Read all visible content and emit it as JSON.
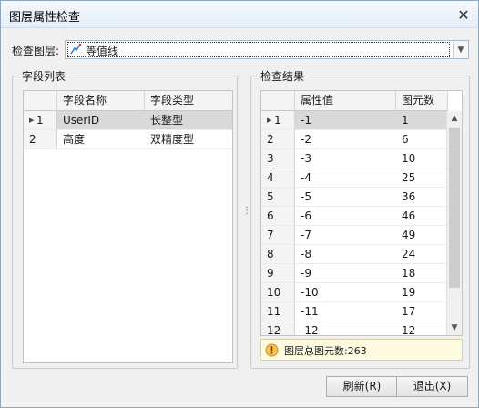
{
  "window": {
    "title": "图层属性检查"
  },
  "layer": {
    "label": "检查图层:",
    "value": "等值线"
  },
  "field_list": {
    "group_title": "字段列表",
    "headers": [
      "字段名称",
      "字段类型"
    ],
    "rows": [
      {
        "num": "1",
        "name": "UserID",
        "type": "长整型",
        "selected": true
      },
      {
        "num": "2",
        "name": "高度",
        "type": "双精度型",
        "selected": false
      }
    ]
  },
  "result": {
    "group_title": "检查结果",
    "headers": [
      "属性值",
      "图元数"
    ],
    "rows": [
      {
        "num": "1",
        "value": "-1",
        "count": "1",
        "selected": true
      },
      {
        "num": "2",
        "value": "-2",
        "count": "6"
      },
      {
        "num": "3",
        "value": "-3",
        "count": "10"
      },
      {
        "num": "4",
        "value": "-4",
        "count": "25"
      },
      {
        "num": "5",
        "value": "-5",
        "count": "36"
      },
      {
        "num": "6",
        "value": "-6",
        "count": "46"
      },
      {
        "num": "7",
        "value": "-7",
        "count": "49"
      },
      {
        "num": "8",
        "value": "-8",
        "count": "24"
      },
      {
        "num": "9",
        "value": "-9",
        "count": "18"
      },
      {
        "num": "10",
        "value": "-10",
        "count": "19"
      },
      {
        "num": "11",
        "value": "-11",
        "count": "17"
      },
      {
        "num": "12",
        "value": "-12",
        "count": "12"
      }
    ]
  },
  "status": {
    "text": "图层总图元数:263",
    "icon": "info-warning-icon"
  },
  "buttons": {
    "refresh": "刷新(R)",
    "exit": "退出(X)"
  },
  "colors": {
    "selected_row": "#d9d9d9",
    "status_bg": "#fffbe0"
  }
}
